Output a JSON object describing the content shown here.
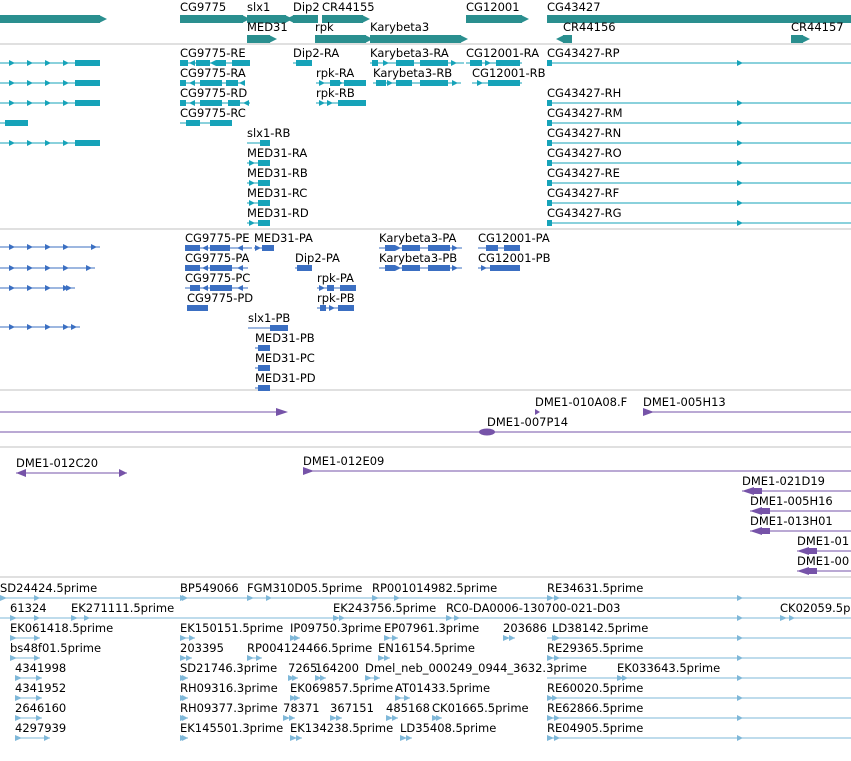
{
  "colors": {
    "gene": "#2a8f8f",
    "transcript": "#16a3b9",
    "protein": "#3b6fc2",
    "clone": "#7653a8",
    "est": "#7fb8d9",
    "divider": "#c0c0c0"
  },
  "tracks": {
    "genes": [
      {
        "name": "CG9775"
      },
      {
        "name": "slx1"
      },
      {
        "name": "Dip2"
      },
      {
        "name": "CR44155"
      },
      {
        "name": "MED31"
      },
      {
        "name": "rpk"
      },
      {
        "name": "Karybeta3"
      },
      {
        "name": "CG12001"
      },
      {
        "name": "CG43427"
      },
      {
        "name": "CR44156"
      },
      {
        "name": "CR44157"
      }
    ],
    "transcripts": [
      {
        "name": "CG9775-RE"
      },
      {
        "name": "CG9775-RA"
      },
      {
        "name": "CG9775-RD"
      },
      {
        "name": "CG9775-RC"
      },
      {
        "name": "Dip2-RA"
      },
      {
        "name": "rpk-RA"
      },
      {
        "name": "rpk-RB"
      },
      {
        "name": "Karybeta3-RA"
      },
      {
        "name": "Karybeta3-RB"
      },
      {
        "name": "CG12001-RA"
      },
      {
        "name": "CG12001-RB"
      },
      {
        "name": "CG43427-RP"
      },
      {
        "name": "CG43427-RH"
      },
      {
        "name": "CG43427-RM"
      },
      {
        "name": "CG43427-RN"
      },
      {
        "name": "CG43427-RO"
      },
      {
        "name": "CG43427-RE"
      },
      {
        "name": "CG43427-RF"
      },
      {
        "name": "CG43427-RG"
      },
      {
        "name": "slx1-RB"
      },
      {
        "name": "MED31-RA"
      },
      {
        "name": "MED31-RB"
      },
      {
        "name": "MED31-RC"
      },
      {
        "name": "MED31-RD"
      }
    ],
    "proteins": [
      {
        "name": "CG9775-PE"
      },
      {
        "name": "MED31-PA"
      },
      {
        "name": "CG9775-PA"
      },
      {
        "name": "CG9775-PC"
      },
      {
        "name": "CG9775-PD"
      },
      {
        "name": "Dip2-PA"
      },
      {
        "name": "rpk-PA"
      },
      {
        "name": "rpk-PB"
      },
      {
        "name": "Karybeta3-PA"
      },
      {
        "name": "Karybeta3-PB"
      },
      {
        "name": "CG12001-PA"
      },
      {
        "name": "CG12001-PB"
      },
      {
        "name": "slx1-PB"
      },
      {
        "name": "MED31-PB"
      },
      {
        "name": "MED31-PC"
      },
      {
        "name": "MED31-PD"
      }
    ],
    "clones_a": [
      {
        "name": "DME1-010A08.F"
      },
      {
        "name": "DME1-005H13"
      },
      {
        "name": "DME1-007P14"
      }
    ],
    "clones_b": [
      {
        "name": "DME1-012C20"
      },
      {
        "name": "DME1-012E09"
      },
      {
        "name": "DME1-021D19"
      },
      {
        "name": "DME1-005H16"
      },
      {
        "name": "DME1-013H01"
      },
      {
        "name": "DME1-01"
      },
      {
        "name": "DME1-00"
      }
    ],
    "ests": [
      {
        "name": "SD24424.5prime"
      },
      {
        "name": "BP549066"
      },
      {
        "name": "FGM310D05.5prime"
      },
      {
        "name": "RP001014982.5prime"
      },
      {
        "name": "RE34631.5prime"
      },
      {
        "name": "61324"
      },
      {
        "name": "EK271111.5prime"
      },
      {
        "name": "EK243756.5prime"
      },
      {
        "name": "RC0-DA0006-130700-021-D03"
      },
      {
        "name": "CK02059.5p"
      },
      {
        "name": "EK061418.5prime"
      },
      {
        "name": "EK150151.5prime"
      },
      {
        "name": "IP09750.3prime"
      },
      {
        "name": "EP07961.3prime"
      },
      {
        "name": "203686"
      },
      {
        "name": "LD38142.5prime"
      },
      {
        "name": "bs48f01.5prime"
      },
      {
        "name": "203395"
      },
      {
        "name": "RP004124466.5prime"
      },
      {
        "name": "EN16154.5prime"
      },
      {
        "name": "RE29365.5prime"
      },
      {
        "name": "4341998"
      },
      {
        "name": "SD21746.3prime"
      },
      {
        "name": "7265"
      },
      {
        "name": "164200"
      },
      {
        "name": "Dmel_neb_000249_0944_3632.3prime"
      },
      {
        "name": "EK033643.5prime"
      },
      {
        "name": "4341952"
      },
      {
        "name": "RH09316.3prime"
      },
      {
        "name": "EK069857.5prime"
      },
      {
        "name": "AT01433.5prime"
      },
      {
        "name": "RE60020.5prime"
      },
      {
        "name": "2646160"
      },
      {
        "name": "RH09377.3prime"
      },
      {
        "name": "78371"
      },
      {
        "name": "367151"
      },
      {
        "name": "485168"
      },
      {
        "name": "CK01665.5prime"
      },
      {
        "name": "RE62866.5prime"
      },
      {
        "name": "4297939"
      },
      {
        "name": "EK145501.3prime"
      },
      {
        "name": "EK134238.5prime"
      },
      {
        "name": "LD35408.5prime"
      },
      {
        "name": "RE04905.5prime"
      }
    ]
  }
}
